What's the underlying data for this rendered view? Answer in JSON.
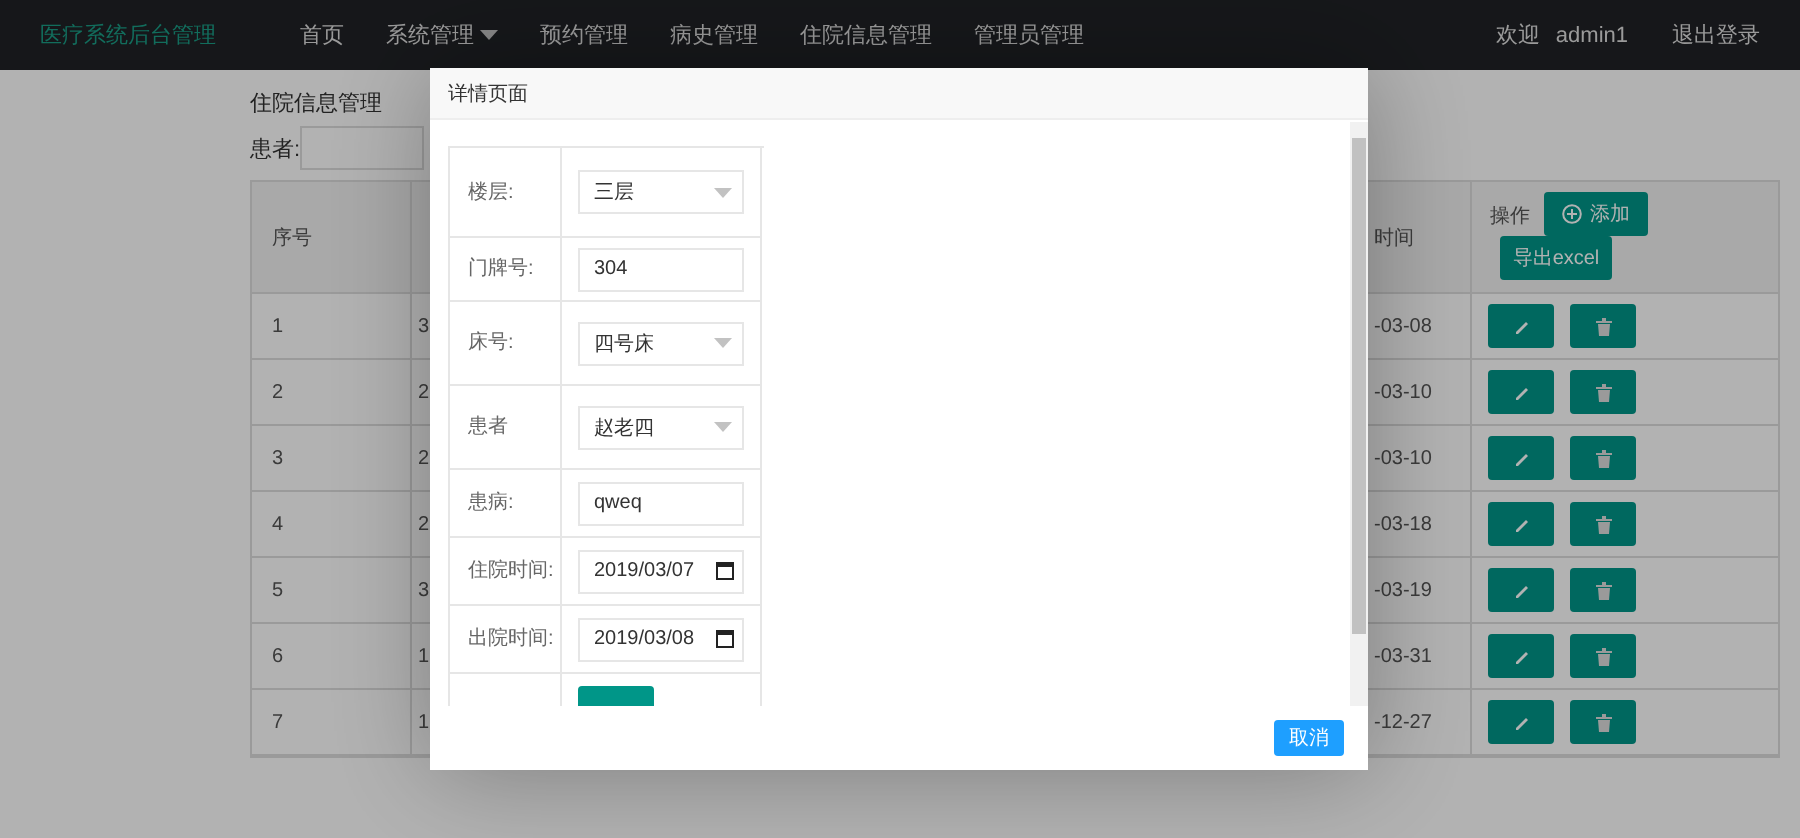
{
  "nav": {
    "brand": "医疗系统后台管理",
    "items": [
      {
        "label": "首页",
        "dropdown": false
      },
      {
        "label": "系统管理",
        "dropdown": true
      },
      {
        "label": "预约管理",
        "dropdown": false
      },
      {
        "label": "病史管理",
        "dropdown": false
      },
      {
        "label": "住院信息管理",
        "dropdown": false
      },
      {
        "label": "管理员管理",
        "dropdown": false
      }
    ],
    "welcome": "欢迎",
    "user": "admin1",
    "logout": "退出登录"
  },
  "page": {
    "title": "住院信息管理",
    "filter_label": "患者:",
    "columns": {
      "index": "序号",
      "date": "时间",
      "actions": "操作"
    },
    "add_button": "添加",
    "export_button": "导出excel",
    "rows": [
      {
        "index": "1",
        "column_2": "3",
        "date": "-03-08"
      },
      {
        "index": "2",
        "column_2": "2",
        "date": "-03-10"
      },
      {
        "index": "3",
        "column_2": "2",
        "date": "-03-10"
      },
      {
        "index": "4",
        "column_2": "2",
        "date": "-03-18"
      },
      {
        "index": "5",
        "column_2": "3",
        "date": "-03-19"
      },
      {
        "index": "6",
        "column_2": "1",
        "date": "-03-31"
      },
      {
        "index": "7",
        "column_2": "1",
        "date": "-12-27"
      }
    ]
  },
  "dialog": {
    "title": "详情页面",
    "fields": [
      {
        "label": "楼层:",
        "kind": "select",
        "value": "三层"
      },
      {
        "label": "门牌号:",
        "kind": "text",
        "value": "304"
      },
      {
        "label": "床号:",
        "kind": "select",
        "value": "四号床"
      },
      {
        "label": "患者",
        "kind": "select",
        "value": "赵老四"
      },
      {
        "label": "患病:",
        "kind": "text",
        "value": "qweq"
      },
      {
        "label": "住院时间:",
        "kind": "date",
        "value": "2019/03/07"
      },
      {
        "label": "出院时间:",
        "kind": "date",
        "value": "2019/03/08"
      },
      {
        "kind": "button"
      }
    ],
    "cancel": "取消"
  }
}
